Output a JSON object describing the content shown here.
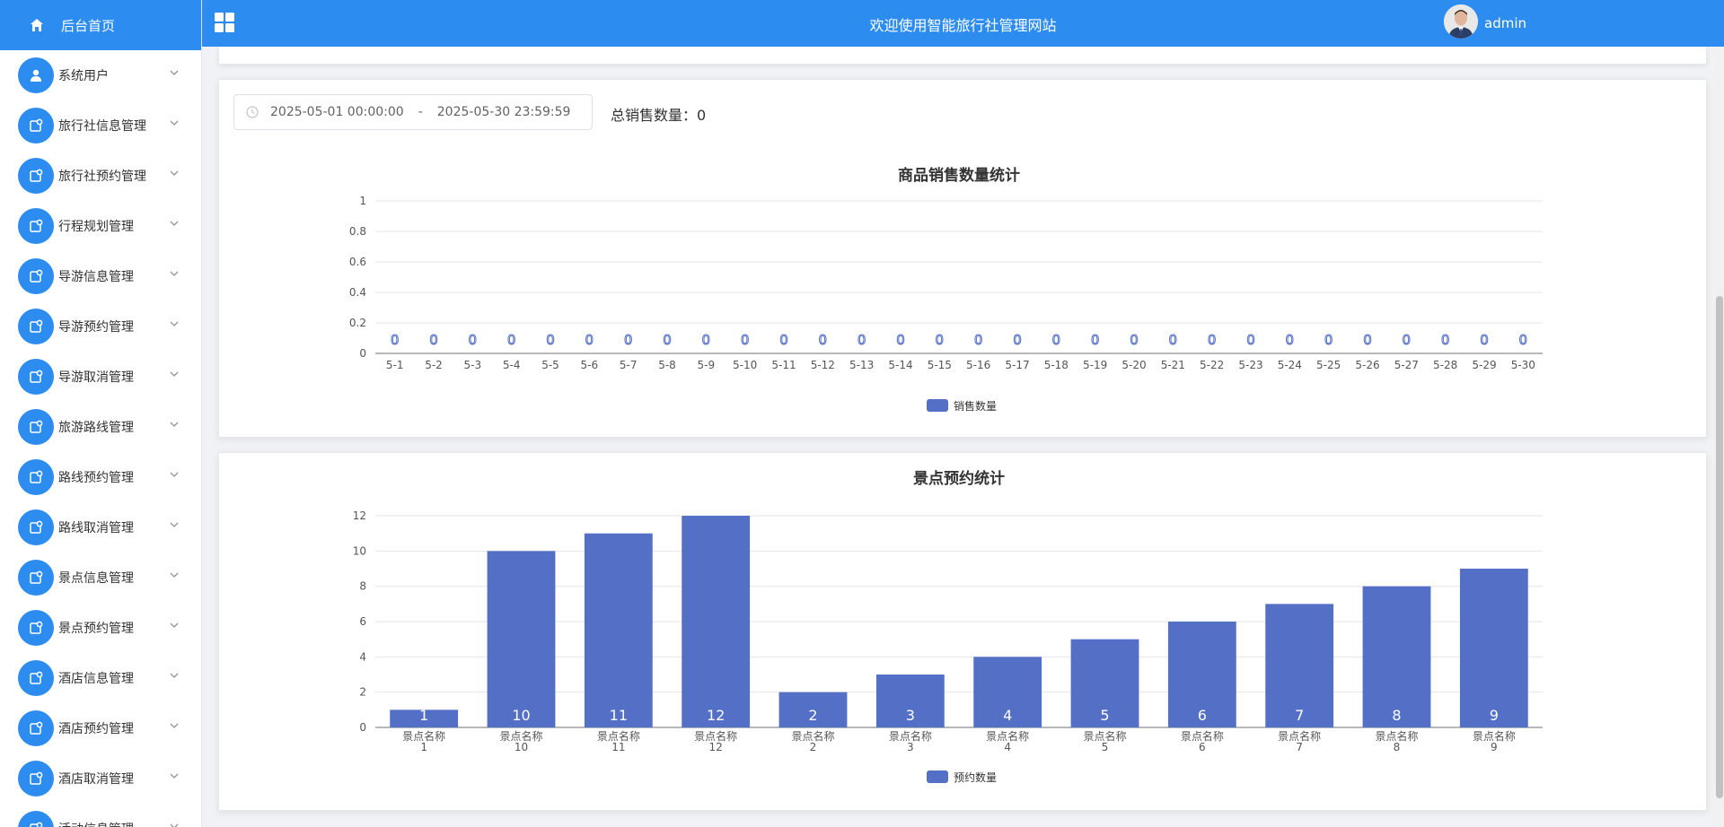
{
  "colors": {
    "primary": "#2d8cf0",
    "bar": "#5470c6"
  },
  "header": {
    "title": "欢迎使用智能旅行社管理网站",
    "username": "admin"
  },
  "sidebar": {
    "home": {
      "label": "后台首页",
      "icon": "home-icon"
    },
    "items": [
      {
        "label": "系统用户",
        "icon": "user-icon"
      },
      {
        "label": "旅行社信息管理",
        "icon": "doc-icon"
      },
      {
        "label": "旅行社预约管理",
        "icon": "doc-icon"
      },
      {
        "label": "行程规划管理",
        "icon": "doc-icon"
      },
      {
        "label": "导游信息管理",
        "icon": "doc-icon"
      },
      {
        "label": "导游预约管理",
        "icon": "doc-icon"
      },
      {
        "label": "导游取消管理",
        "icon": "doc-icon"
      },
      {
        "label": "旅游路线管理",
        "icon": "doc-icon"
      },
      {
        "label": "路线预约管理",
        "icon": "doc-icon"
      },
      {
        "label": "路线取消管理",
        "icon": "doc-icon"
      },
      {
        "label": "景点信息管理",
        "icon": "doc-icon"
      },
      {
        "label": "景点预约管理",
        "icon": "doc-icon"
      },
      {
        "label": "酒店信息管理",
        "icon": "doc-icon"
      },
      {
        "label": "酒店预约管理",
        "icon": "doc-icon"
      },
      {
        "label": "酒店取消管理",
        "icon": "doc-icon"
      },
      {
        "label": "活动信息管理",
        "icon": "doc-icon"
      }
    ]
  },
  "filters": {
    "start": "2025-05-01 00:00:00",
    "separator": "-",
    "end": "2025-05-30 23:59:59",
    "total_label": "总销售数量：",
    "total_value": "0"
  },
  "chart_data": [
    {
      "type": "bar",
      "title": "商品销售数量统计",
      "categories": [
        "5-1",
        "5-2",
        "5-3",
        "5-4",
        "5-5",
        "5-6",
        "5-7",
        "5-8",
        "5-9",
        "5-10",
        "5-11",
        "5-12",
        "5-13",
        "5-14",
        "5-15",
        "5-16",
        "5-17",
        "5-18",
        "5-19",
        "5-20",
        "5-21",
        "5-22",
        "5-23",
        "5-24",
        "5-25",
        "5-26",
        "5-27",
        "5-28",
        "5-29",
        "5-30"
      ],
      "series": [
        {
          "name": "销售数量",
          "values": [
            0,
            0,
            0,
            0,
            0,
            0,
            0,
            0,
            0,
            0,
            0,
            0,
            0,
            0,
            0,
            0,
            0,
            0,
            0,
            0,
            0,
            0,
            0,
            0,
            0,
            0,
            0,
            0,
            0,
            0
          ]
        }
      ],
      "yticks": [
        "0",
        "0.2",
        "0.4",
        "0.6",
        "0.8",
        "1"
      ],
      "ylim": [
        0,
        1
      ],
      "grid": true,
      "legend": "bottom-center"
    },
    {
      "type": "bar",
      "title": "景点预约统计",
      "categories": [
        "景点名称1",
        "景点名称10",
        "景点名称11",
        "景点名称12",
        "景点名称2",
        "景点名称3",
        "景点名称4",
        "景点名称5",
        "景点名称6",
        "景点名称7",
        "景点名称8",
        "景点名称9"
      ],
      "series": [
        {
          "name": "预约数量",
          "values": [
            1,
            10,
            11,
            12,
            2,
            3,
            4,
            5,
            6,
            7,
            8,
            9
          ]
        }
      ],
      "yticks": [
        "0",
        "2",
        "4",
        "6",
        "8",
        "10",
        "12"
      ],
      "ylim": [
        0,
        12
      ],
      "grid": true,
      "legend": "bottom-center"
    }
  ]
}
